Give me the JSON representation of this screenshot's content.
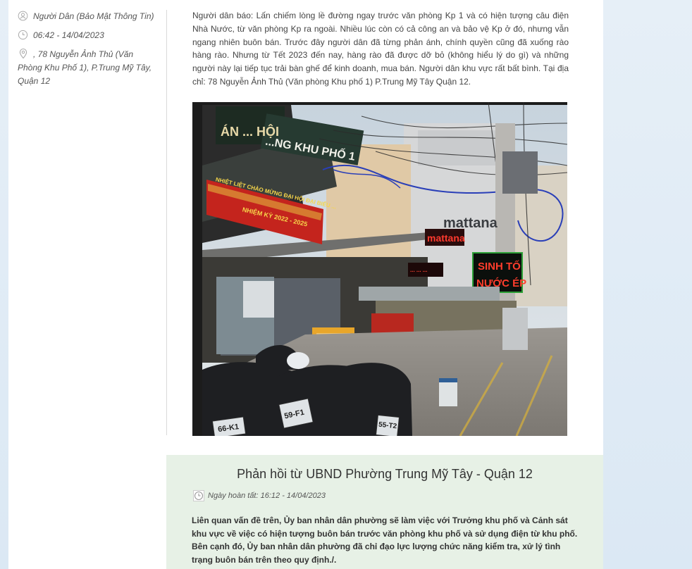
{
  "meta": {
    "author": "Người Dân (Bảo Mật Thông Tin)",
    "time": "06:42 - 14/04/2023",
    "address": ", 78 Nguyễn Ảnh Thủ (Văn Phòng Khu Phố 1), P.Trung Mỹ Tây, Quận 12",
    "icons": [
      "user-icon",
      "clock-icon",
      "location-pin-icon"
    ]
  },
  "report": {
    "text": "Người dân báo: Lấn chiếm lòng lề đường ngay trước văn phòng Kp 1 và có hiện tượng câu điện Nhà Nước, từ văn phòng Kp ra ngoài. Nhiều lúc còn có cả công an và bảo vệ Kp ở đó, nhưng vẫn ngang nhiên buôn bán. Trước đây người dân đã từng phản ánh, chính quyền cũng đã xuống rào hàng rào. Nhưng từ Tết 2023 đến nay, hàng rào đã được dỡ bỏ (không hiểu lý do gì) và những người này lại tiếp tục trải bàn ghế để kinh doanh, mua bán. Người dân khu vực rất bất bình. Tại địa chỉ: 78 Nguyễn Ảnh Thủ (Văn phòng Khu phố 1) P.Trung Mỹ Tây Quận 12."
  },
  "photo": {
    "signs": {
      "banner_top": "ÁN ... HỘI",
      "office": "...NG KHU PHỐ 1",
      "red_banner_line1": "NHIỆT LIỆT CHÀO MỪNG ĐẠI HỘI ĐẠI BIỂU ...",
      "red_banner_line2": "NHIỆM KỲ 2022 - 2025",
      "store": "mattana",
      "led_mattana": "mattana",
      "led_small": "... ... ...",
      "led_line1": "SINH TỐ",
      "led_line2": "NƯỚC ÉP",
      "plate1": "66-K1",
      "plate2": "59-F1",
      "plate3": "55-T2"
    }
  },
  "response": {
    "title": "Phản hồi từ UBND Phường Trung Mỹ Tây - Quận 12",
    "date_label": "Ngày hoàn tất: 16:12 - 14/04/2023",
    "body": "Liên quan vấn đề trên, Ủy ban nhân dân phường sẽ làm việc với Trưởng khu phố và Cảnh sát khu vực về việc có hiện tượng buôn bán trước văn phòng khu phố và sử dụng điện từ khu phố. Bên cạnh đó, Ủy ban nhân dân phường đã chỉ đạo lực lượng chức năng kiểm tra, xử lý tình trạng buôn bán trên theo quy định./."
  }
}
